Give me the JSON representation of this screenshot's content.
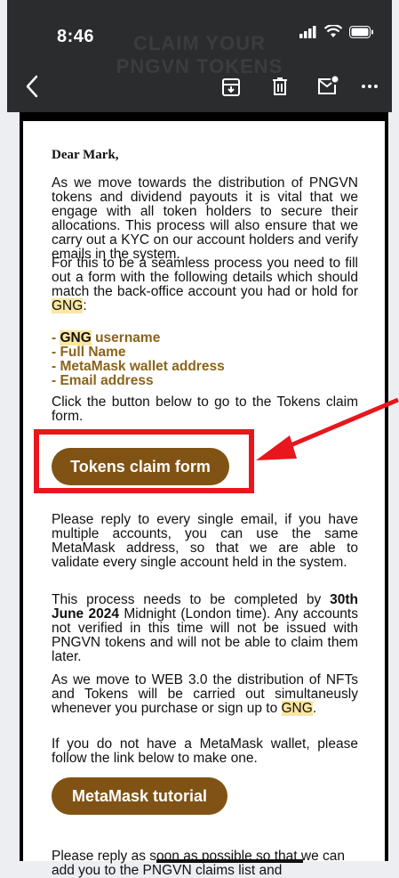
{
  "status_bar": {
    "time": "8:46"
  },
  "ghost_header": {
    "line1": "CLAIM YOUR",
    "line2": "PNGVN TOKENS"
  },
  "toolbar": {
    "back_icon": "chevron-left-icon",
    "archive_icon": "archive-icon",
    "delete_icon": "trash-icon",
    "mark_unread_icon": "mail-unread-icon",
    "more_icon": "more-horizontal-icon"
  },
  "email": {
    "greeting": "Dear Mark,",
    "p1": "As we move towards the distribution of PNGVN tokens and dividend payouts it is vital that we engage with all token holders to secure their allocations. This process will also ensure that we carry out a KYC on our account holders and verify emails in the system.",
    "p2_before": "For this to be a seamless process you need to fill out a form with the following details which should match the back-office account you had or hold for ",
    "p2_hl": "GNG",
    "p2_after": ":",
    "list": {
      "dash": "- ",
      "item1_hl": "GNG",
      "item1_rest": " username",
      "item2": "- Full Name",
      "item3": "- MetaMask wallet address",
      "item4": "- Email address"
    },
    "p3": "Click the button below to go to the Tokens claim form.",
    "button1": "Tokens claim form",
    "p4": "Please reply to every single email, if you have multiple accounts, you can use the same MetaMask address, so that we are able to validate every single account held in the system.",
    "p5_before": "This process needs to be completed by ",
    "p5_bold": "30th June 2024",
    "p5_after": " Midnight (London time). Any accounts not verified in this time will not be issued with PNGVN tokens and will not be able to claim them later.",
    "p6_before": "As we move to WEB 3.0 the distribution of NFTs and Tokens will be carried out simultaneusly whenever you purchase or sign up to ",
    "p6_hl": "GNG",
    "p6_after": ".",
    "p7": "If you do not have a MetaMask wallet, please follow the link below to make one.",
    "button2": "MetaMask tutorial",
    "p8": "Please reply as soon as possible so that we can add you to the PNGVN claims list and"
  },
  "colors": {
    "accent_button": "#805314",
    "highlight": "#fbe6a2",
    "annotation_red": "#e8161d",
    "list_text": "#8a6419"
  }
}
